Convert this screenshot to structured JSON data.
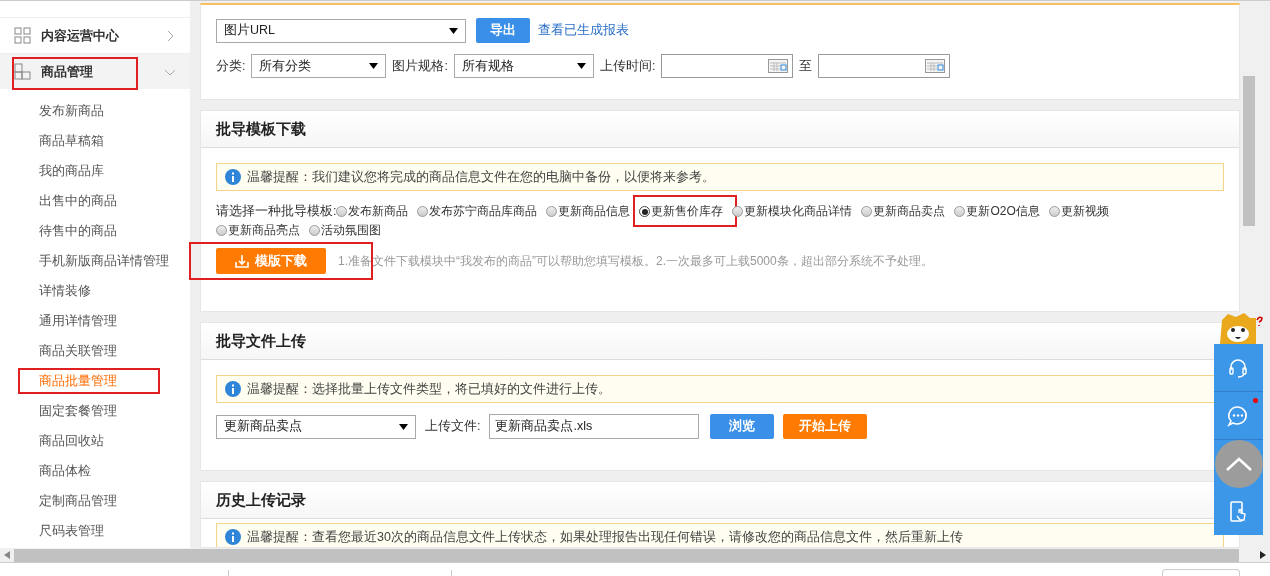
{
  "sidebar": {
    "groups": [
      {
        "label": "内容运营中心",
        "expanded": false,
        "highlighted": false,
        "selected": false
      },
      {
        "label": "商品管理",
        "expanded": true,
        "highlighted": true,
        "selected": true
      }
    ],
    "items": [
      {
        "label": "发布新商品",
        "selected": false,
        "highlighted": false
      },
      {
        "label": "商品草稿箱",
        "selected": false,
        "highlighted": false
      },
      {
        "label": "我的商品库",
        "selected": false,
        "highlighted": false
      },
      {
        "label": "出售中的商品",
        "selected": false,
        "highlighted": false
      },
      {
        "label": "待售中的商品",
        "selected": false,
        "highlighted": false
      },
      {
        "label": "手机新版商品详情管理",
        "selected": false,
        "highlighted": false
      },
      {
        "label": "详情装修",
        "selected": false,
        "highlighted": false
      },
      {
        "label": "通用详情管理",
        "selected": false,
        "highlighted": false
      },
      {
        "label": "商品关联管理",
        "selected": false,
        "highlighted": false
      },
      {
        "label": "商品批量管理",
        "selected": true,
        "highlighted": true
      },
      {
        "label": "固定套餐管理",
        "selected": false,
        "highlighted": false
      },
      {
        "label": "商品回收站",
        "selected": false,
        "highlighted": false
      },
      {
        "label": "商品体检",
        "selected": false,
        "highlighted": false
      },
      {
        "label": "定制商品管理",
        "selected": false,
        "highlighted": false
      },
      {
        "label": "尺码表管理",
        "selected": false,
        "highlighted": false
      }
    ]
  },
  "export_panel": {
    "type_select": "图片URL",
    "export_button": "导出",
    "report_link": "查看已生成报表",
    "filters": [
      {
        "label": "分类:",
        "value": "所有分类"
      },
      {
        "label": "图片规格:",
        "value": "所有规格"
      }
    ],
    "time_label": "上传时间:",
    "range_separator": "至"
  },
  "template_section": {
    "title": "批导模板下载",
    "notice": "温馨提醒：我们建议您将完成的商品信息文件在您的电脑中备份，以便将来参考。",
    "choose_label": "请选择一种批导模板:",
    "options": [
      {
        "label": "发布新商品",
        "selected": false,
        "highlighted": false
      },
      {
        "label": "发布苏宁商品库商品",
        "selected": false,
        "highlighted": false
      },
      {
        "label": "更新商品信息",
        "selected": false,
        "highlighted": false
      },
      {
        "label": "更新售价库存",
        "selected": true,
        "highlighted": true
      },
      {
        "label": "更新模块化商品详情",
        "selected": false,
        "highlighted": false
      },
      {
        "label": "更新商品卖点",
        "selected": false,
        "highlighted": false
      },
      {
        "label": "更新O2O信息",
        "selected": false,
        "highlighted": false
      },
      {
        "label": "更新视频",
        "selected": false,
        "highlighted": false
      },
      {
        "label": "更新商品亮点",
        "selected": false,
        "highlighted": false
      },
      {
        "label": "活动氛围图",
        "selected": false,
        "highlighted": false
      }
    ],
    "download_button": {
      "label": "模版下载",
      "highlighted": true
    },
    "hint": "1.准备文件下载模块中“我发布的商品”可以帮助您填写模板。2.一次最多可上载5000条，超出部分系统不予处理。"
  },
  "upload_section": {
    "title": "批导文件上传",
    "notice": "温馨提醒：选择批量上传文件类型，将已填好的文件进行上传。",
    "type_select": "更新商品卖点",
    "file_label": "上传文件:",
    "file_value": "更新商品卖点.xls",
    "browse_button": "浏览",
    "upload_button": "开始上传"
  },
  "history_section": {
    "title": "历史上传记录",
    "notice": "温馨提醒：查看您最近30次的商品信息文件上传状态，如果处理报告出现任何错误，请修改您的商品信息文件，然后重新上传"
  },
  "float_toolbar": {
    "items": [
      {
        "kind": "headset"
      },
      {
        "kind": "chat",
        "unread": true
      },
      {
        "kind": "phone"
      }
    ]
  }
}
